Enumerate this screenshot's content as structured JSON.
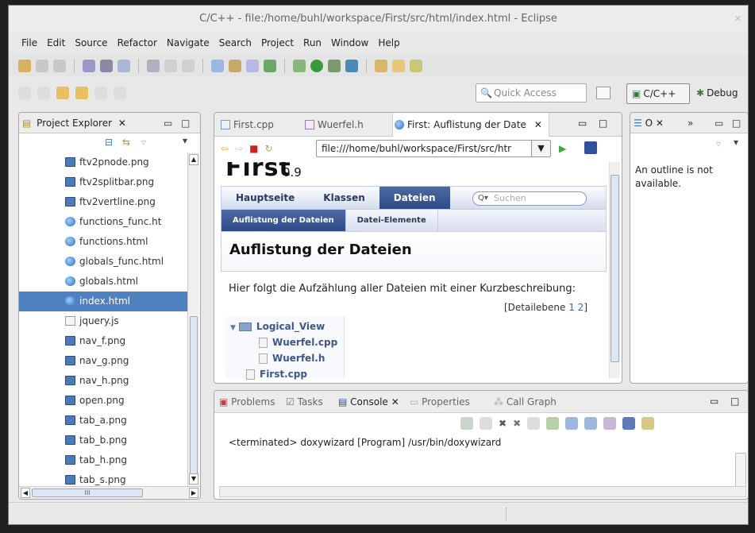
{
  "window": {
    "title": "C/C++ - file:/home/buhl/workspace/First/src/html/index.html - Eclipse"
  },
  "menu": [
    "File",
    "Edit",
    "Source",
    "Refactor",
    "Navigate",
    "Search",
    "Project",
    "Run",
    "Window",
    "Help"
  ],
  "quick_access": {
    "placeholder": "Quick Access"
  },
  "perspectives": {
    "cpp": "C/C++",
    "debug": "Debug"
  },
  "project_explorer": {
    "title": "Project Explorer",
    "files": [
      {
        "name": "ftv2pnode.png",
        "type": "png"
      },
      {
        "name": "ftv2splitbar.png",
        "type": "png"
      },
      {
        "name": "ftv2vertline.png",
        "type": "png"
      },
      {
        "name": "functions_func.ht",
        "type": "html"
      },
      {
        "name": "functions.html",
        "type": "html"
      },
      {
        "name": "globals_func.html",
        "type": "html"
      },
      {
        "name": "globals.html",
        "type": "html"
      },
      {
        "name": "index.html",
        "type": "html",
        "selected": true
      },
      {
        "name": "jquery.js",
        "type": "js"
      },
      {
        "name": "nav_f.png",
        "type": "png"
      },
      {
        "name": "nav_g.png",
        "type": "png"
      },
      {
        "name": "nav_h.png",
        "type": "png"
      },
      {
        "name": "open.png",
        "type": "png"
      },
      {
        "name": "tab_a.png",
        "type": "png"
      },
      {
        "name": "tab_b.png",
        "type": "png"
      },
      {
        "name": "tab_h.png",
        "type": "png"
      },
      {
        "name": "tab_s.png",
        "type": "png"
      }
    ]
  },
  "editor": {
    "tabs": [
      "First.cpp",
      "Wuerfel.h",
      "First: Auflistung der Date"
    ],
    "url": "file:///home/buhl/workspace/First/src/htr",
    "page": {
      "project": "First",
      "version": "0.9",
      "main_tabs": [
        "Hauptseite",
        "Klassen",
        "Dateien"
      ],
      "search_placeholder": "Suchen",
      "sub_tabs": [
        "Auflistung der Dateien",
        "Datei-Elemente"
      ],
      "heading": "Auflistung der Dateien",
      "description": "Hier folgt die Aufzählung aller Dateien mit einer Kurzbeschreibung:",
      "detail_label": "[Detailebene",
      "detail_levels": [
        "1",
        "2"
      ],
      "detail_close": "]",
      "tree": {
        "folder": "Logical_View",
        "children": [
          "Wuerfel.cpp",
          "Wuerfel.h"
        ],
        "next": "First.cpp"
      }
    }
  },
  "outline": {
    "title": "O",
    "message": "An outline is not available."
  },
  "console": {
    "tabs": [
      "Problems",
      "Tasks",
      "Console",
      "Properties",
      "Call Graph"
    ],
    "terminated": "<terminated> doxywizard [Program] /usr/bin/doxywizard"
  },
  "colors": {
    "selection": "#4f80c0",
    "doxy_nav": "#2e4a84",
    "link": "#3d578c"
  }
}
